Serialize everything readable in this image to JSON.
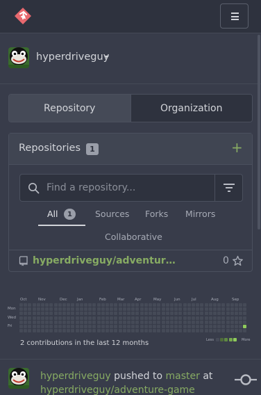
{
  "nav": {
    "logo": "gitea-logo",
    "menu_icon": "hamburger-icon"
  },
  "user": {
    "name": "hyperdriveguy",
    "avatar": "avatar-image",
    "menu_icon": "caret-down-icon"
  },
  "context_tabs": [
    {
      "label": "Repository",
      "active": true
    },
    {
      "label": "Organization",
      "active": false
    }
  ],
  "repos_panel": {
    "title": "Repositories",
    "count": "1",
    "add_icon": "plus-icon",
    "search": {
      "placeholder": "Find a repository...",
      "value": "",
      "icon": "search-icon"
    },
    "filter_icon": "filter-icon",
    "tabs": {
      "all": {
        "label": "All",
        "count": "1"
      },
      "sources": "Sources",
      "forks": "Forks",
      "mirrors": "Mirrors",
      "collaborative": "Collaborative"
    },
    "repo": {
      "name": "hyperdriveguy/adventure-game",
      "display_name": "hyperdriveguy/adventure-g...",
      "stars": "0",
      "icon": "repo-icon",
      "star_icon": "star-icon"
    }
  },
  "heatmap": {
    "months": [
      "Oct",
      "Nov",
      "Dec",
      "Jan",
      "Feb",
      "Mar",
      "Apr",
      "May",
      "Jun",
      "Jul",
      "Aug",
      "Sep"
    ],
    "days": [
      "Mon",
      "Wed",
      "Fri"
    ],
    "summary": "2 contributions in the last 12 months",
    "legend_less": "Less",
    "legend_more": "More",
    "colors": {
      "empty": "#454a57",
      "levels": [
        "#4f6b3a",
        "#5f8a42",
        "#76a84d",
        "#8fcb5c"
      ]
    },
    "active_cells": [
      {
        "week": 52,
        "day": 5,
        "level": 3
      }
    ]
  },
  "feed": {
    "user": "hyperdriveguy",
    "action": "pushed to",
    "branch": "master",
    "preposition": "at",
    "repo": "hyperdriveguy/adventure-game",
    "icon": "commit-icon"
  },
  "colors": {
    "background": "#383c4a",
    "surface": "#2e323e",
    "link_green": "#87ab63",
    "border": "#4b505e"
  }
}
